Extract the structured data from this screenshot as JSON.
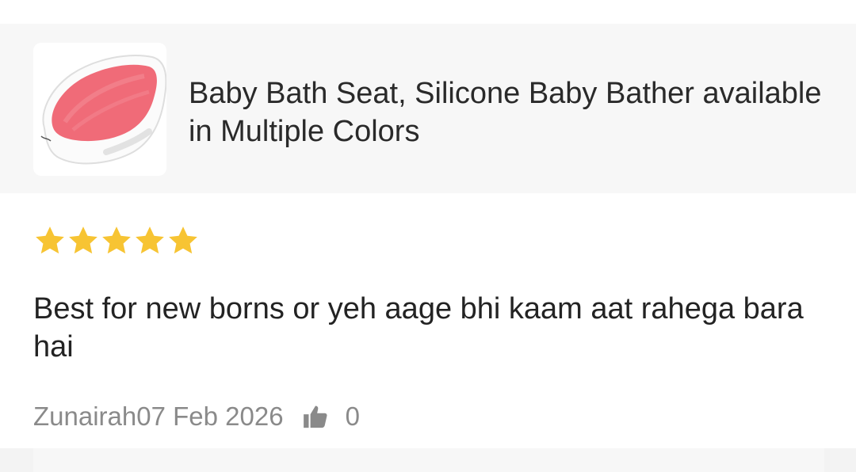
{
  "product": {
    "title": "Baby Bath Seat, Silicone Baby Bather available in Multiple Colors",
    "thumbnail": "baby-bath-seat-image",
    "seat_color": "#f06b78",
    "frame_color": "#ffffff"
  },
  "review": {
    "rating": 5,
    "max_rating": 5,
    "star_color": "#f7c433",
    "text": "Best for new borns or yeh aage bhi kaam aat rahega bara hai",
    "meta_text": "Zunairah07 Feb 2026",
    "like_icon": "thumbs-up-icon",
    "like_count": "0"
  }
}
